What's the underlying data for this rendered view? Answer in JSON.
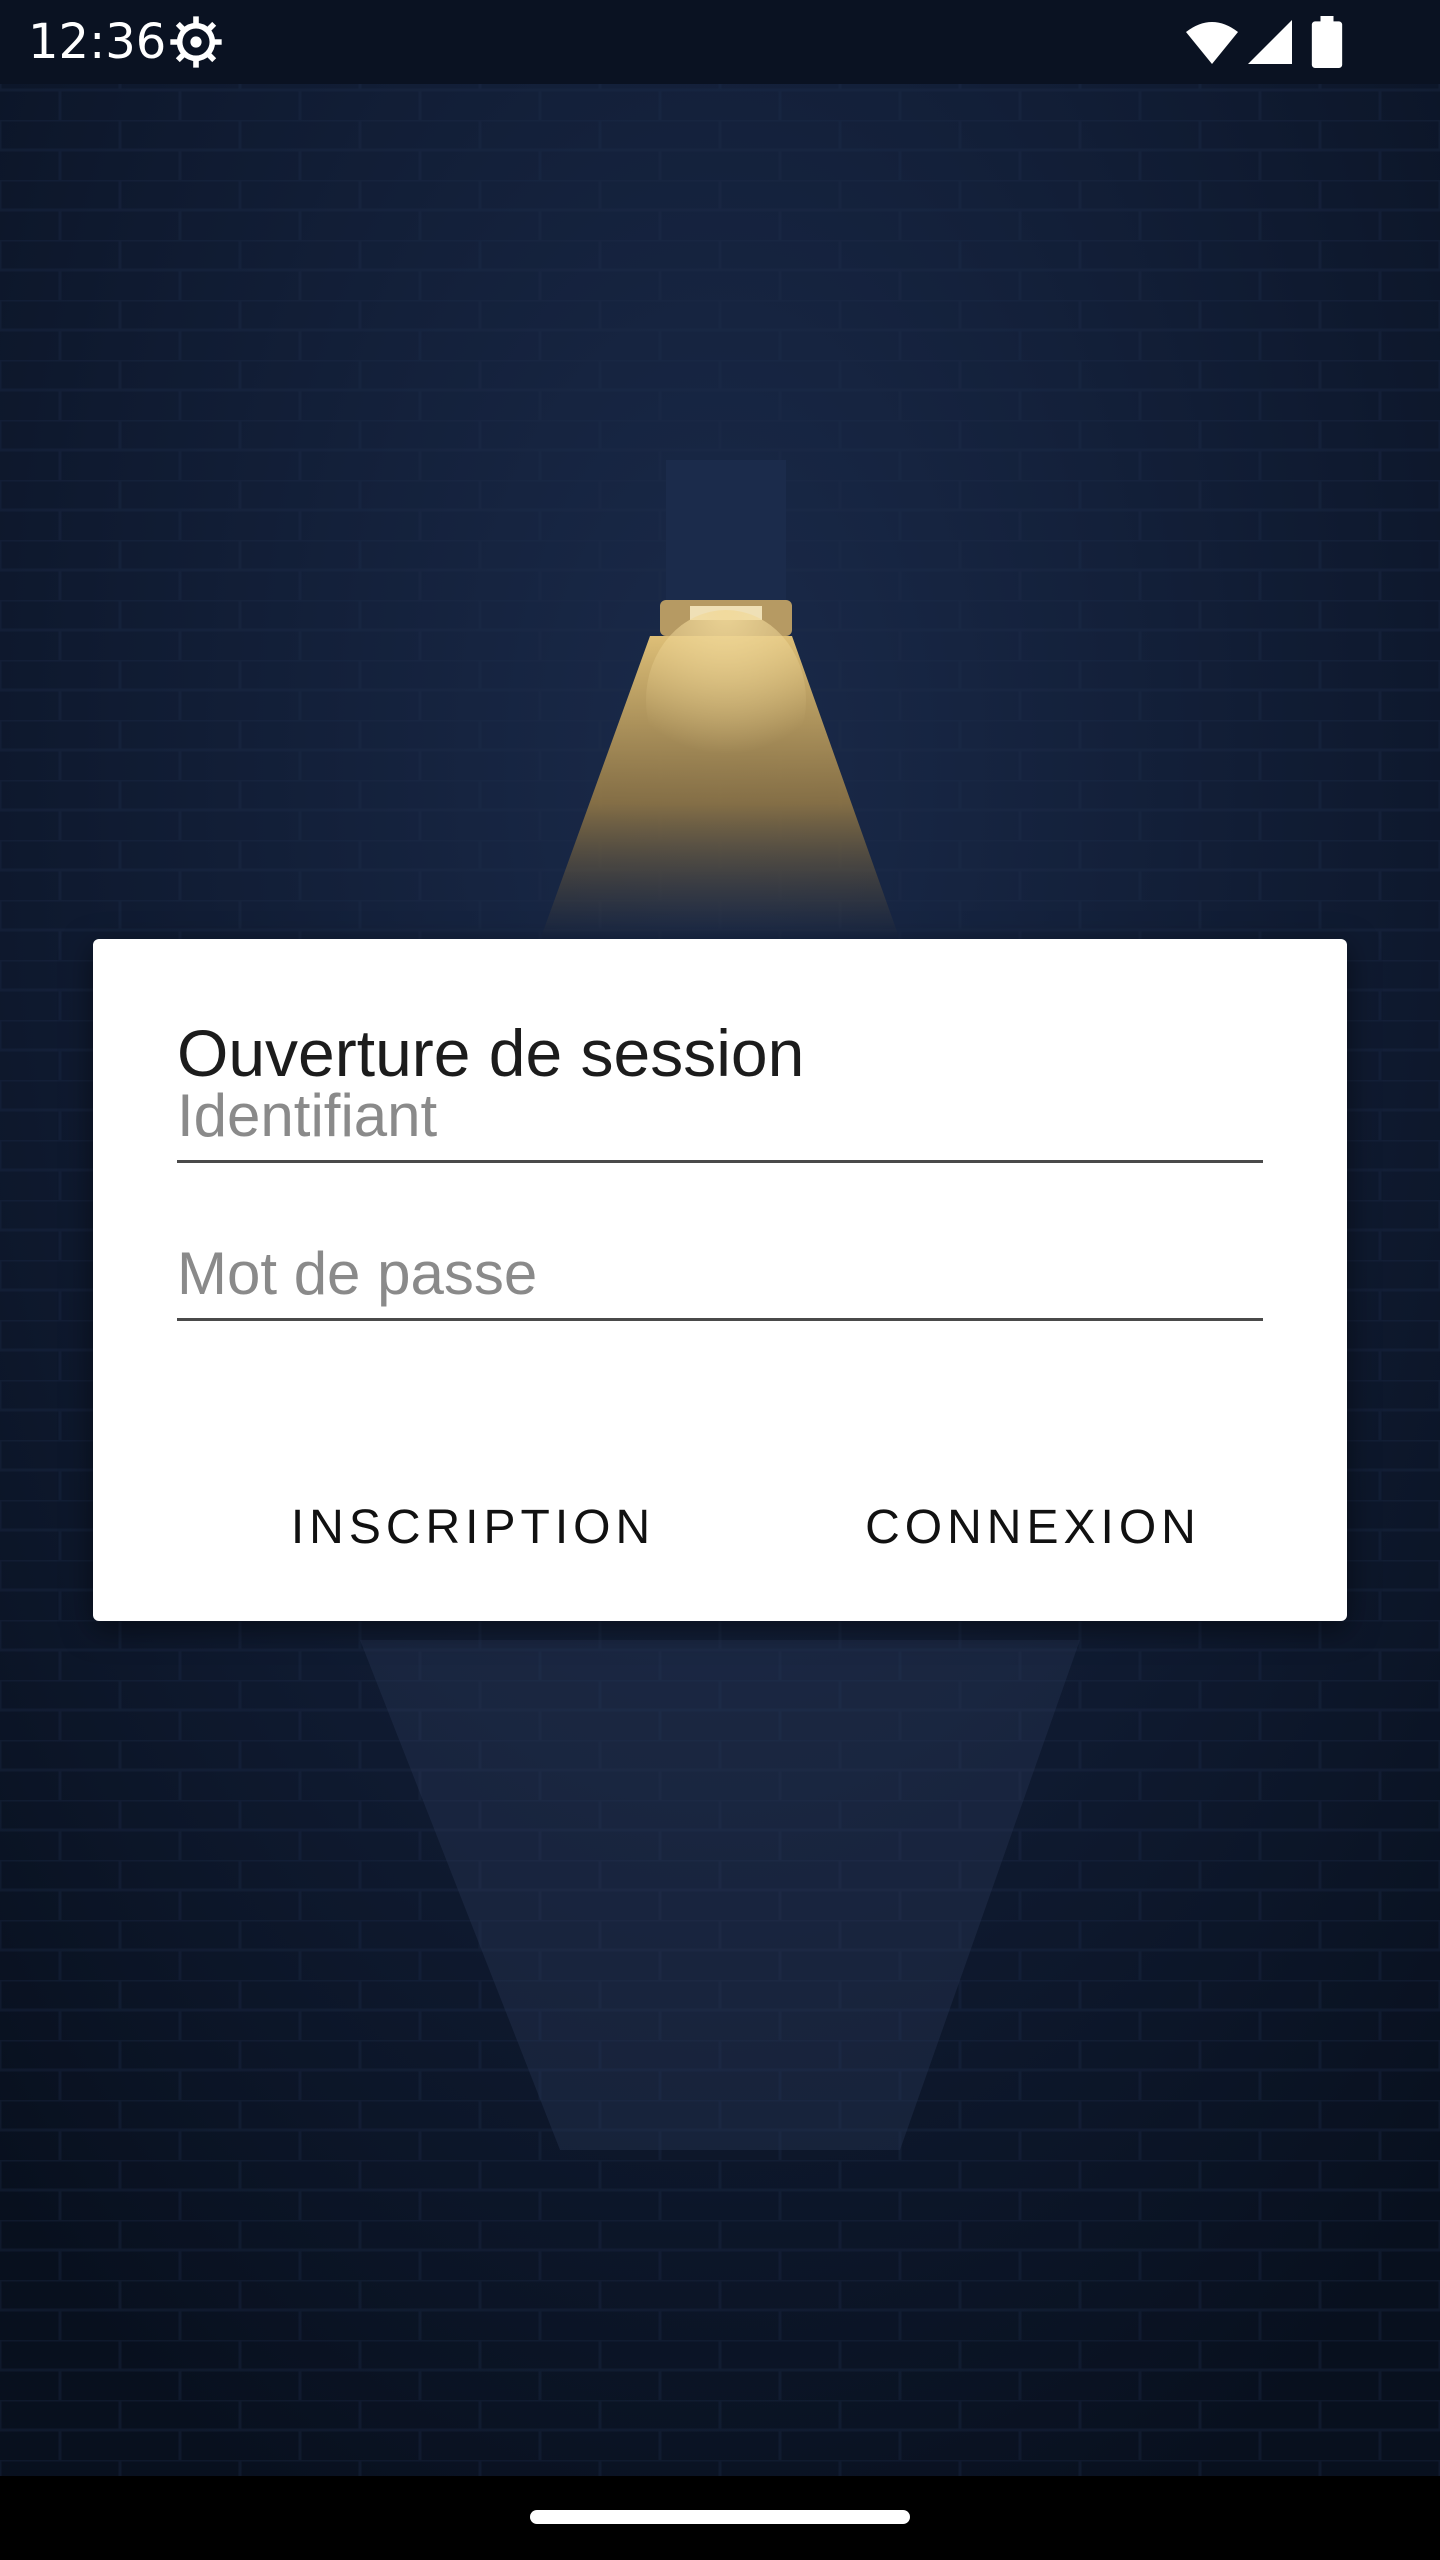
{
  "status_bar": {
    "time": "12:36",
    "icons": [
      "settings-icon",
      "wifi-icon",
      "signal-icon",
      "battery-icon"
    ]
  },
  "dialog": {
    "title": "Ouverture de session",
    "username_placeholder": "Identifiant",
    "username_value": "",
    "password_placeholder": "Mot de passe",
    "password_value": "",
    "signup_label": "INSCRIPTION",
    "login_label": "CONNEXION"
  },
  "colors": {
    "background": "#0d1729",
    "dialog": "#ffffff",
    "lamp_light": "#c9a85c"
  }
}
